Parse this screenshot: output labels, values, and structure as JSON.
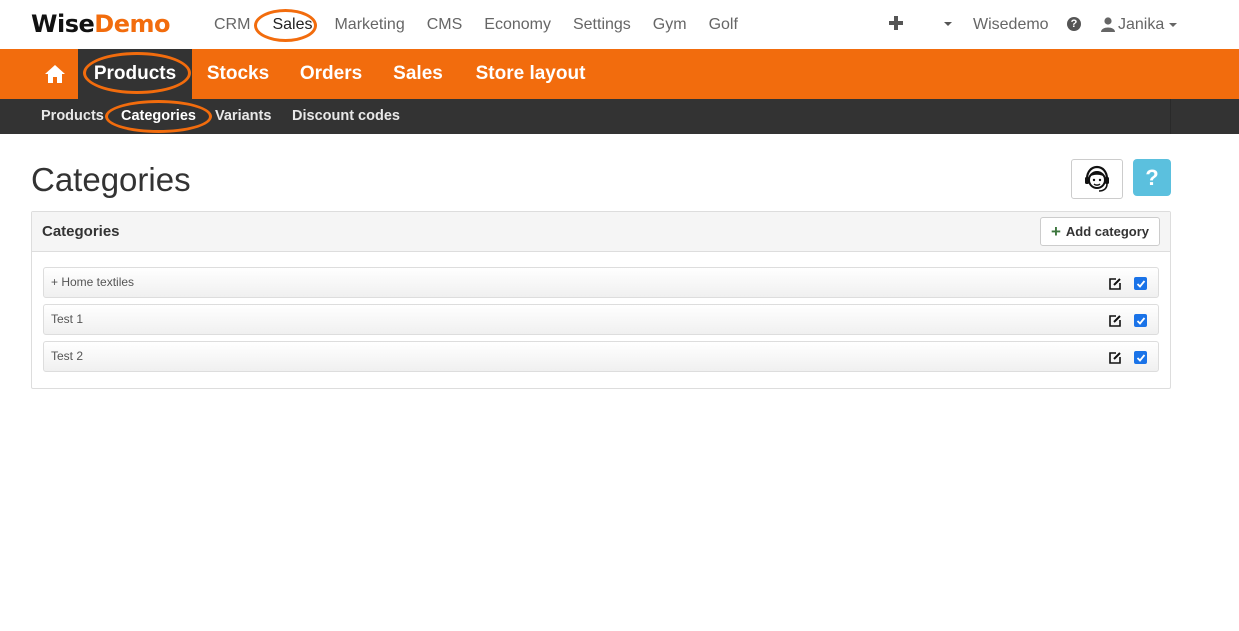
{
  "brand": {
    "logo_part1": "Wise",
    "logo_part2": "Demo"
  },
  "topnav": {
    "items": [
      {
        "label": "CRM"
      },
      {
        "label": "Sales"
      },
      {
        "label": "Marketing"
      },
      {
        "label": "CMS"
      },
      {
        "label": "Economy"
      },
      {
        "label": "Settings"
      },
      {
        "label": "Gym"
      },
      {
        "label": "Golf"
      }
    ],
    "active": "Sales",
    "org_name": "Wisedemo",
    "user_name": "Janika"
  },
  "mainnav": {
    "tabs": [
      {
        "label": "Products"
      },
      {
        "label": "Stocks"
      },
      {
        "label": "Orders"
      },
      {
        "label": "Sales"
      },
      {
        "label": "Store layout"
      }
    ],
    "active": "Products"
  },
  "subnav": {
    "items": [
      {
        "label": "Products"
      },
      {
        "label": "Categories"
      },
      {
        "label": "Variants"
      },
      {
        "label": "Discount codes"
      }
    ],
    "active": "Categories"
  },
  "page": {
    "title": "Categories",
    "help_label": "?"
  },
  "panel": {
    "title": "Categories",
    "add_button_label": "Add category",
    "rows": [
      {
        "label": "+ Home textiles",
        "checked": true
      },
      {
        "label": "Test 1",
        "checked": true
      },
      {
        "label": "Test 2",
        "checked": true
      }
    ]
  },
  "colors": {
    "brand_orange": "#f26c0d",
    "dark_bar": "#333333",
    "help_blue": "#5bc0de",
    "checkbox_blue": "#1a73e8"
  },
  "icons": {
    "home": "home-icon",
    "plus": "plus-icon",
    "help": "question-circle-icon",
    "user": "user-icon",
    "support": "headset-support-icon",
    "edit": "edit-icon"
  }
}
